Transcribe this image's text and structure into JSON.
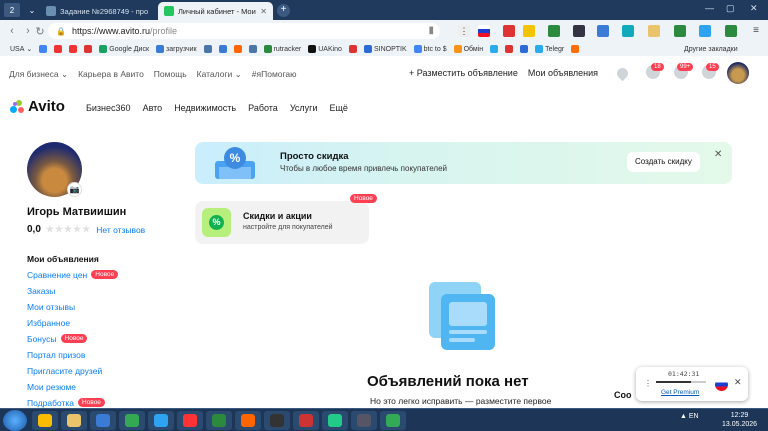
{
  "browser": {
    "tabs": [
      {
        "label": "2",
        "kind": "counter"
      },
      {
        "label": "Задание №2968749 - про",
        "active": false,
        "color": "#6a8fb0"
      },
      {
        "label": "Личный кабинет - Мои",
        "active": true,
        "color": "#22c55e"
      }
    ],
    "new_tab": "+",
    "window_controls": [
      "—",
      "▢",
      "✕"
    ],
    "url_host": "https://www.avito.ru",
    "url_path": "/profile",
    "bookmarks": [
      {
        "label": "USA",
        "color": "#eef3f8"
      },
      {
        "label": "",
        "color": "#4285f4"
      },
      {
        "label": "",
        "color": "#e33"
      },
      {
        "label": "",
        "color": "#e33"
      },
      {
        "label": "",
        "color": "#d33"
      },
      {
        "label": "Google Диск",
        "color": "#1aa260"
      },
      {
        "label": "загрузчик",
        "color": "#3a7bd5"
      },
      {
        "label": "",
        "color": "#4a76a8"
      },
      {
        "label": "",
        "color": "#3a7bd5"
      },
      {
        "label": "",
        "color": "#f60"
      },
      {
        "label": "",
        "color": "#4a76a8"
      },
      {
        "label": "rutracker",
        "color": "#2b8a3e"
      },
      {
        "label": "UAKino",
        "color": "#111"
      },
      {
        "label": "",
        "color": "#d33"
      },
      {
        "label": "SINOPTIK",
        "color": "#2a6bd6"
      },
      {
        "label": "btc to $",
        "color": "#4285f4"
      },
      {
        "label": "Обмін",
        "color": "#f7931a"
      },
      {
        "label": "",
        "color": "#2aabee"
      },
      {
        "label": "",
        "color": "#d33"
      },
      {
        "label": "",
        "color": "#2a6bd6"
      },
      {
        "label": "Telegr",
        "color": "#2aabee"
      },
      {
        "label": "",
        "color": "#ff6d00"
      }
    ],
    "other_bookmarks": "Другие закладки"
  },
  "header": {
    "top_links": [
      "Для бизнеса ⌄",
      "Карьера в Авито",
      "Помощь",
      "Каталоги ⌄",
      "#яПомогаю"
    ],
    "post_ad": "+ Разместить объявление",
    "my_ads": "Мои объявления",
    "badges": {
      "notifications": "18",
      "messages": "99+",
      "cart": "15"
    },
    "logo": "Avito",
    "main_nav": [
      "Бизнес360",
      "Авто",
      "Недвижимость",
      "Работа",
      "Услуги",
      "Ещё"
    ]
  },
  "profile": {
    "name": "Игорь Матвиишин",
    "rating": "0,0",
    "stars": "★★★★★",
    "no_reviews": "Нет отзывов",
    "menu_title": "Мои объявления",
    "menu": [
      {
        "label": "Сравнение цен",
        "badge": "Новое"
      },
      {
        "label": "Заказы",
        "badge": null
      },
      {
        "label": "Мои отзывы",
        "badge": null
      },
      {
        "label": "Избранное",
        "badge": null
      },
      {
        "label": "Бонусы",
        "badge": "Новое"
      },
      {
        "label": "Портал призов",
        "badge": null
      },
      {
        "label": "Пригласите друзей",
        "badge": null
      },
      {
        "label": "Мои резюме",
        "badge": null
      },
      {
        "label": "Подработка",
        "badge": "Новое"
      }
    ]
  },
  "promo_discount": {
    "title": "Просто скидка",
    "subtitle": "Чтобы в любое время привлечь покупателей",
    "button": "Создать скидку",
    "close": "✕"
  },
  "promo_sales": {
    "title": "Скидки и акции",
    "subtitle": "настройте для покупателей",
    "badge": "Новое"
  },
  "empty_state": {
    "title": "Объявлений пока нет",
    "subtitle": "Но это легко исправить — разместите первое"
  },
  "player": {
    "time": "01:42:31",
    "link": "Get Premium",
    "progress": 0.7,
    "close": "✕"
  },
  "cookie_text": "Coo",
  "taskbar": {
    "lang": "EN",
    "time": "12:29",
    "date": "13.05.2026",
    "apps": [
      {
        "name": "chrome",
        "color": "#fbbc04"
      },
      {
        "name": "explorer",
        "color": "#e9c46a"
      },
      {
        "name": "w-app",
        "color": "#3a7bd5"
      },
      {
        "name": "chrome2",
        "color": "#34a853"
      },
      {
        "name": "globe",
        "color": "#2ea3f2"
      },
      {
        "name": "yandex",
        "color": "#f33"
      },
      {
        "name": "green-app",
        "color": "#2b8a3e"
      },
      {
        "name": "player",
        "color": "#f60"
      },
      {
        "name": "terminal",
        "color": "#333"
      },
      {
        "name": "64",
        "color": "#c33"
      },
      {
        "name": "chart",
        "color": "#2c8"
      },
      {
        "name": "app12",
        "color": "#556"
      },
      {
        "name": "app13",
        "color": "#3a5"
      }
    ]
  }
}
